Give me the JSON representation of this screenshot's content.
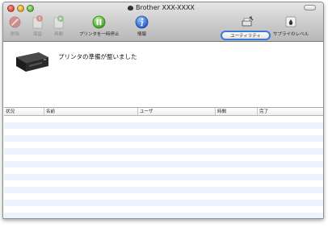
{
  "window": {
    "title": "Brother XXX-XXXX"
  },
  "toolbar": {
    "delete_label": "削除",
    "hold_label": "保留",
    "resume_label": "再開",
    "pause_printer_label": "プリンタを一時停止",
    "info_label": "情報",
    "utility_label": "ユーティリティ",
    "supply_levels_label": "サプライのレベル"
  },
  "status": {
    "message": "プリンタの準備が整いました"
  },
  "jobs_table": {
    "columns": [
      "状況",
      "名前",
      "ユーザ",
      "時間",
      "完了"
    ],
    "rows": []
  },
  "colors": {
    "focus_ring": "#3b7ad8",
    "row_stripe": "#edf3fe",
    "pause_icon": "#5cc23a",
    "info_icon": "#2f6fd6"
  }
}
